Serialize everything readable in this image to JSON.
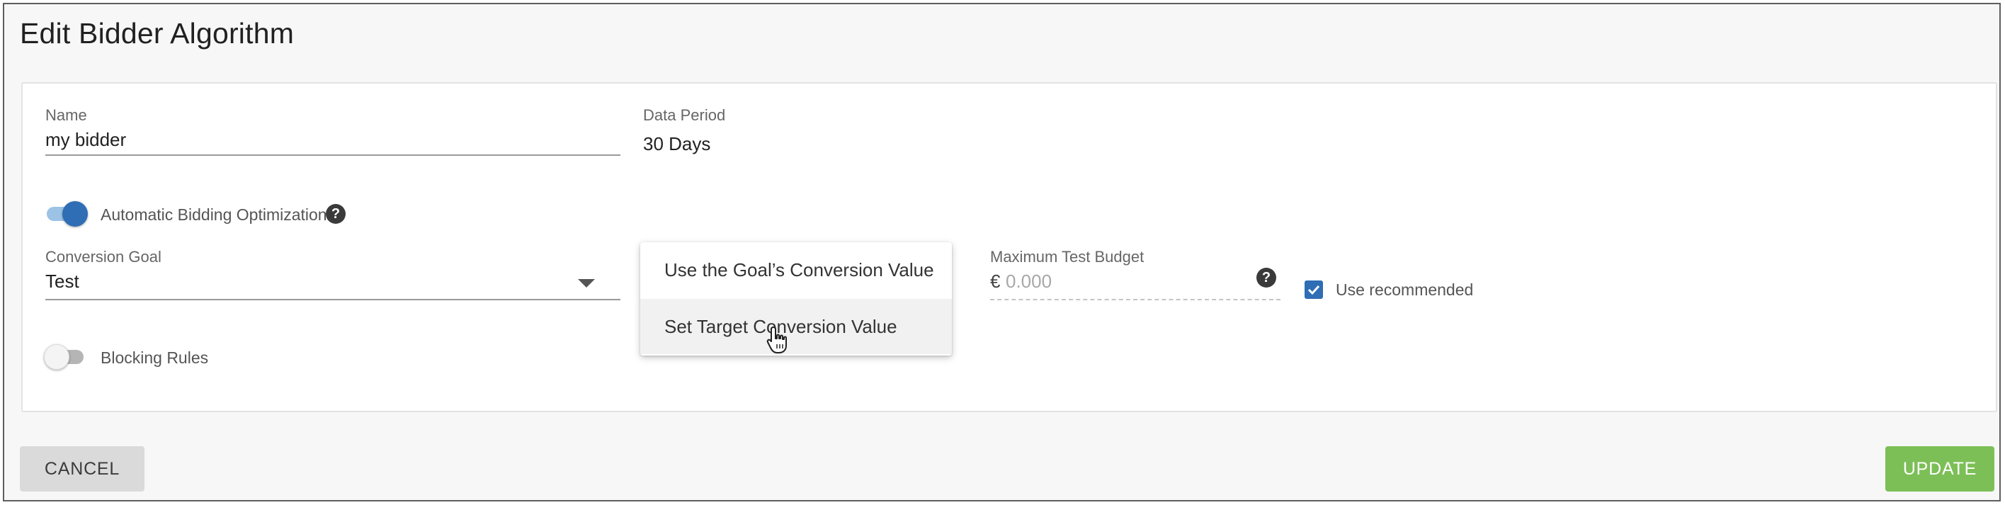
{
  "page": {
    "title": "Edit Bidder Algorithm"
  },
  "form": {
    "name": {
      "label": "Name",
      "value": "my bidder"
    },
    "data_period": {
      "label": "Data Period",
      "value": "30 Days"
    },
    "auto_bidding": {
      "label": "Automatic Bidding Optimization",
      "enabled": true
    },
    "conversion_goal": {
      "label": "Conversion Goal",
      "value": "Test"
    },
    "max_test_budget": {
      "label": "Maximum Test Budget",
      "currency": "€",
      "placeholder": "0.000"
    },
    "use_recommended": {
      "label": "Use recommended",
      "checked": true
    },
    "blocking_rules": {
      "label": "Blocking Rules",
      "enabled": false
    }
  },
  "dropdown": {
    "items": [
      {
        "label": "Use the Goal’s Conversion Value"
      },
      {
        "label": "Set Target Conversion Value"
      }
    ]
  },
  "actions": {
    "cancel_label": "CANCEL",
    "update_label": "UPDATE"
  },
  "colors": {
    "accent": "#2f6db5",
    "update": "#7cbf57",
    "cancel": "#dadada"
  }
}
